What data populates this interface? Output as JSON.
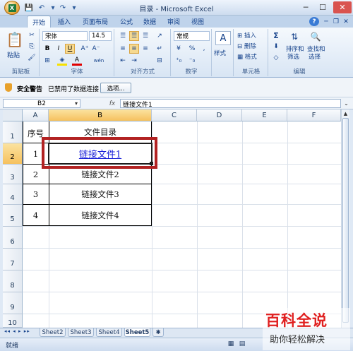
{
  "window": {
    "title": "目录 - Microsoft Excel"
  },
  "tabs": [
    {
      "label": "开始"
    },
    {
      "label": "插入"
    },
    {
      "label": "页面布局"
    },
    {
      "label": "公式"
    },
    {
      "label": "数据"
    },
    {
      "label": "审阅"
    },
    {
      "label": "视图"
    }
  ],
  "ribbon": {
    "clipboard": {
      "paste": "粘贴",
      "label": "剪贴板"
    },
    "font": {
      "name": "宋体",
      "size": "14.5",
      "bold": "B",
      "italic": "I",
      "underline": "U",
      "label": "字体",
      "font_color_letter": "A",
      "wen": "wén"
    },
    "alignment": {
      "label": "对齐方式"
    },
    "number": {
      "format": "常规",
      "percent": "%",
      "comma": ",",
      "label": "数字"
    },
    "styles": {
      "label": "样式"
    },
    "cells": {
      "insert": "插入",
      "delete": "删除",
      "format": "格式",
      "label": "单元格"
    },
    "editing": {
      "sort": "排序和",
      "sort2": "筛选",
      "find": "查找和",
      "find2": "选择",
      "label": "编辑",
      "sigma": "Σ"
    }
  },
  "security": {
    "title": "安全警告",
    "message": "已禁用了数据连接",
    "options_button": "选项..."
  },
  "formula_bar": {
    "name_box": "B2",
    "fx": "fx",
    "content": "链接文件1"
  },
  "sheet": {
    "columns": [
      "A",
      "B",
      "C",
      "D",
      "E",
      "F"
    ],
    "rows": [
      "1",
      "2",
      "3",
      "4",
      "5",
      "6",
      "7",
      "8",
      "9",
      "10"
    ],
    "cells": {
      "A1": "序号",
      "B1": "文件目录",
      "A2": "1",
      "B2": "链接文件1",
      "A3": "2",
      "B3": "链接文件2",
      "A4": "3",
      "B4": "链接文件3",
      "A5": "4",
      "B5": "链接文件4"
    },
    "selected": "B2"
  },
  "sheet_tabs": [
    "Sheet2",
    "Sheet3",
    "Sheet4",
    "Sheet5"
  ],
  "status": {
    "ready": "就绪"
  },
  "watermark": {
    "line1": "百科全说",
    "line2": "助你轻松解决"
  },
  "colors": {
    "selection_outline": "#b22222",
    "hyperlink": "#1a20d8",
    "header_highlight": "#f6c15e"
  }
}
